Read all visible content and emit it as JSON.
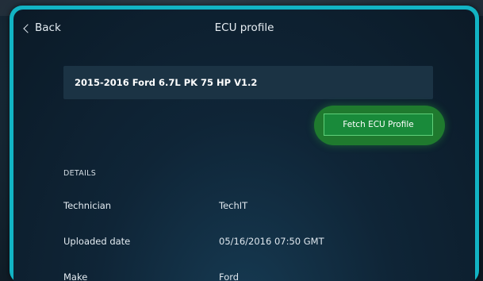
{
  "header": {
    "back_label": "Back",
    "title": "ECU profile"
  },
  "profile": {
    "name": "2015-2016 Ford 6.7L PK 75 HP V1.2"
  },
  "actions": {
    "fetch_label": "Fetch ECU Profile"
  },
  "details": {
    "section_label": "DETAILS",
    "rows": [
      {
        "label": "Technician",
        "value": "TechIT"
      },
      {
        "label": "Uploaded date",
        "value": "05/16/2016 07:50 GMT"
      },
      {
        "label": "Make",
        "value": "Ford"
      }
    ]
  },
  "colors": {
    "device_frame": "#12b4c4",
    "accent_button": "#198a3a",
    "button_border": "#5fd07a"
  }
}
